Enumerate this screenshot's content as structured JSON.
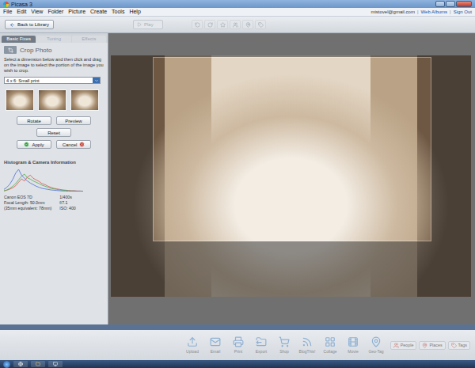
{
  "window": {
    "title": "Picasa 3"
  },
  "menu": [
    "File",
    "Edit",
    "View",
    "Folder",
    "Picture",
    "Create",
    "Tools",
    "Help"
  ],
  "account": {
    "email": "mistovel@gmail.com",
    "links": [
      "Web Albums",
      "Sign Out"
    ]
  },
  "toolbar": {
    "back": "Back to Library",
    "play": {
      "label": "Play",
      "disabled": true
    },
    "tools": [
      {
        "disabled": true
      },
      {
        "disabled": true
      },
      {
        "disabled": true
      },
      {
        "disabled": true
      },
      {
        "disabled": true
      },
      {
        "disabled": true
      }
    ]
  },
  "tabs": [
    {
      "label": "Basic Fixes",
      "selected": true
    },
    {
      "label": "Tuning",
      "selected": false
    },
    {
      "label": "Effects",
      "selected": false
    }
  ],
  "crop": {
    "title": "Crop Photo",
    "instructions": "Select a dimension below and then click and drag on the image to select the portion of the image you wish to crop.",
    "dimension": "4 x 6: Small print",
    "thumbnails": [
      {
        "selected": false
      },
      {
        "selected": false
      },
      {
        "selected": false
      }
    ],
    "buttons": [
      {
        "label": "Rotate",
        "kind": "plain"
      },
      {
        "label": "Preview",
        "kind": "plain"
      },
      {
        "label": "Reset",
        "kind": "plain"
      },
      {
        "label": "Apply",
        "kind": "confirm"
      },
      {
        "label": "Cancel",
        "kind": "cancel"
      }
    ]
  },
  "histogram": {
    "title": "Histogram & Camera Information",
    "series": [
      {
        "name": "red",
        "color": "#d9534f",
        "values": [
          2,
          5,
          9,
          14,
          22,
          35,
          48,
          40,
          55,
          62,
          50,
          44,
          38,
          30,
          26,
          20,
          16,
          12,
          10,
          8,
          6,
          5,
          4,
          3,
          3,
          2,
          2,
          1
        ]
      },
      {
        "name": "green",
        "color": "#4cae4c",
        "values": [
          3,
          6,
          12,
          20,
          30,
          44,
          58,
          66,
          52,
          47,
          40,
          35,
          30,
          24,
          20,
          16,
          12,
          10,
          8,
          6,
          5,
          4,
          3,
          2,
          2,
          1,
          1,
          1
        ]
      },
      {
        "name": "blue",
        "color": "#4a6fd8",
        "values": [
          8,
          16,
          28,
          46,
          70,
          84,
          62,
          50,
          40,
          32,
          26,
          20,
          16,
          12,
          10,
          8,
          6,
          5,
          4,
          3,
          2,
          2,
          1,
          1,
          1,
          1,
          0,
          0
        ]
      }
    ],
    "camera": [
      {
        "label": "Canon EOS 7D",
        "value": "1/400s"
      },
      {
        "label": "Focal Length: 50.0mm",
        "value": "f/7.1"
      },
      {
        "label": "(35mm equivalent: 78mm)",
        "value": "ISO: 400"
      }
    ]
  },
  "tray": {
    "actions": [
      {
        "label": "Upload",
        "disabled": true
      },
      {
        "label": "Email",
        "disabled": true
      },
      {
        "label": "Print",
        "disabled": true
      },
      {
        "label": "Export",
        "disabled": true
      },
      {
        "label": "Shop",
        "disabled": true
      },
      {
        "label": "BlogThis!",
        "disabled": true
      },
      {
        "label": "Collage",
        "disabled": true
      },
      {
        "label": "Movie",
        "disabled": true
      },
      {
        "label": "Geo-Tag",
        "disabled": true
      }
    ],
    "views": [
      {
        "label": "People",
        "disabled": true
      },
      {
        "label": "Places",
        "disabled": true
      },
      {
        "label": "Tags",
        "disabled": true
      }
    ]
  }
}
